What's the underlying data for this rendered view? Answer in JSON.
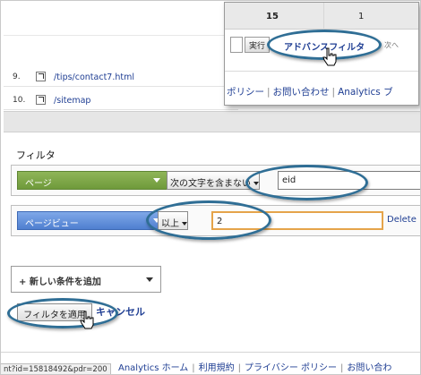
{
  "report": {
    "rows": [
      {
        "num": "9.",
        "url": "/tips/contact7.html"
      },
      {
        "num": "10.",
        "url": "/sitemap"
      }
    ]
  },
  "inset": {
    "col_value_a": "15",
    "col_value_b": "1",
    "run_button": "実行",
    "advanced_filter_link": "アドバンスフィルタ",
    "next_text": "次へ",
    "footer_links": [
      "ポリシー",
      "お問い合わせ",
      "Analytics ブ"
    ]
  },
  "filter": {
    "title": "フィルタ",
    "conditions": [
      {
        "dimension": "ページ",
        "operator": "次の文字を含まない",
        "value": "eid",
        "color": "#7ba64a"
      },
      {
        "dimension": "ページビュー",
        "operator": "以上",
        "value": "2",
        "delete": "Delete",
        "color": "#5b8ad8"
      }
    ],
    "add_condition": "+ 新しい条件を追加",
    "apply_button": "フィルタを適用",
    "cancel_link": "キャンセル"
  },
  "footer": {
    "links": [
      "Analytics ホーム",
      "利用規約",
      "プライバシー ポリシー",
      "お問い合わ"
    ],
    "status_text": "nt?id=15818492&pdr=200"
  },
  "colors": {
    "oval": "#2f6e95",
    "link": "#1f3e93",
    "orange_focus": "#e5a44a"
  }
}
